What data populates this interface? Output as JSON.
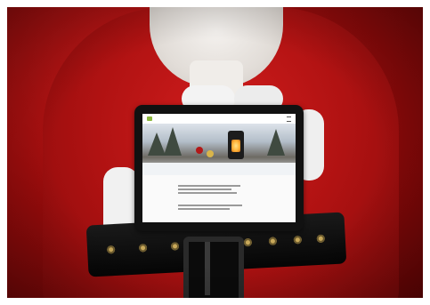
{
  "scene": {
    "subject": "santa-holding-tablet",
    "colors": {
      "background_red": "#9a0c0c",
      "suit_red": "#c41818",
      "fur_white": "#f0ede9",
      "belt_black": "#0b0b0b",
      "site_accent_green": "#8ab63b"
    }
  },
  "tablet_screen": {
    "logo_icon": "leaf-logo-icon",
    "menu_icon": "hamburger-menu-icon",
    "brand_text": "",
    "heading_1": "",
    "heading_2": ""
  }
}
